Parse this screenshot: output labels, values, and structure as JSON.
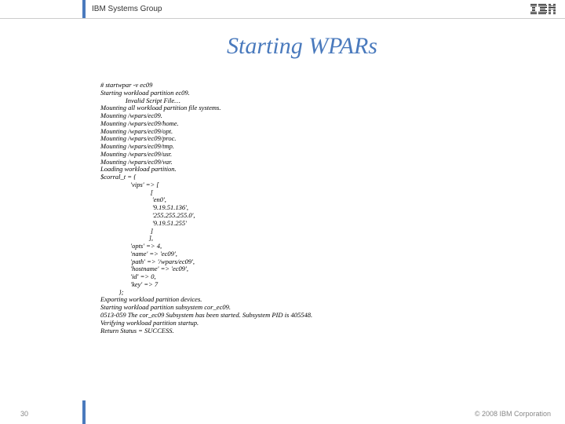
{
  "header": {
    "group_label": "IBM Systems Group",
    "logo_text": "IBM"
  },
  "slide": {
    "title": "Starting WPARs"
  },
  "terminal": {
    "lines": "# startwpar -v ec09\nStarting workload partition ec09.\n               Invalid Script File…\nMounting all workload partition file systems.\nMounting /wpars/ec09.\nMounting /wpars/ec09/home.\nMounting /wpars/ec09/opt.\nMounting /wpars/ec09/proc.\nMounting /wpars/ec09/tmp.\nMounting /wpars/ec09/usr.\nMounting /wpars/ec09/var.\nLoading workload partition.\n$corral_t = {\n                  'vips' => [\n                              [\n                               'en0',\n                               '9.19.51.136',\n                               '255.255.255.0',\n                               '9.19.51.255'\n                              ]\n                             ],\n                  'opts' => 4,\n                  'name' => 'ec09',\n                  'path' => '/wpars/ec09',\n                  'hostname' => 'ec09',\n                  'id' => 0,\n                  'key' => 7\n           };\nExporting workload partition devices.\nStarting workload partition subsystem cor_ec09.\n0513-059 The cor_ec09 Subsystem has been started. Subsystem PID is 405548.\nVerifying workload partition startup.\nReturn Status = SUCCESS."
  },
  "footer": {
    "page_number": "30",
    "copyright": "© 2008 IBM Corporation"
  }
}
